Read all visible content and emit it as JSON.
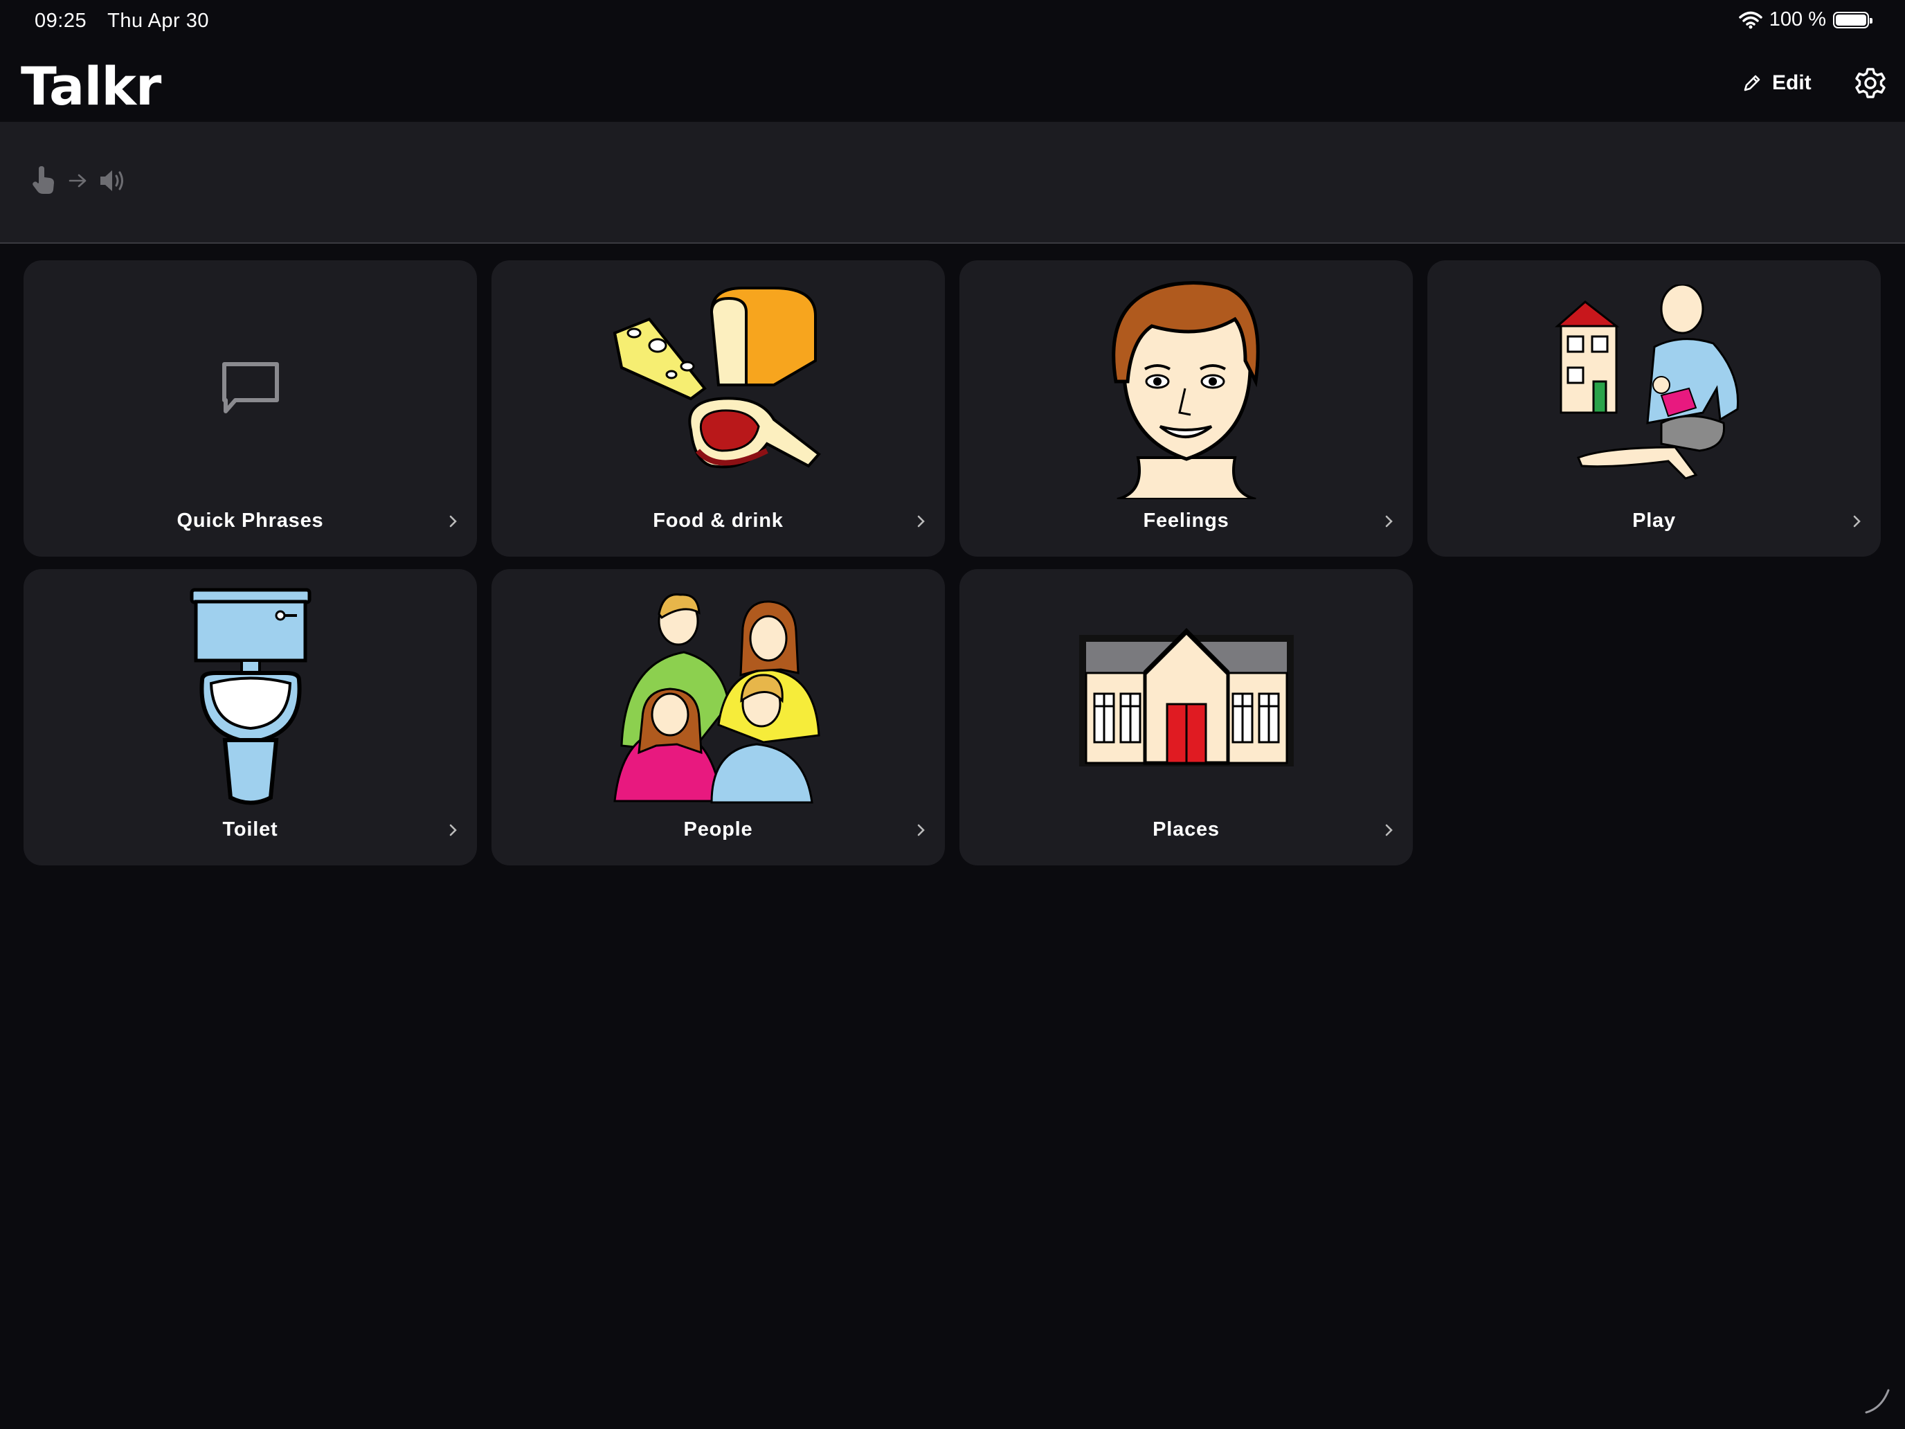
{
  "status_bar": {
    "time": "09:25",
    "date": "Thu Apr 30",
    "battery": "100 %"
  },
  "header": {
    "app_title": "Talkr",
    "edit_label": "Edit"
  },
  "tiles": [
    {
      "label": "Quick Phrases",
      "icon": "chat-bubble-icon"
    },
    {
      "label": "Food & drink",
      "icon": "food-icon"
    },
    {
      "label": "Feelings",
      "icon": "face-icon"
    },
    {
      "label": "Play",
      "icon": "play-icon"
    },
    {
      "label": "Toilet",
      "icon": "toilet-icon"
    },
    {
      "label": "People",
      "icon": "people-icon"
    },
    {
      "label": "Places",
      "icon": "building-icon"
    }
  ],
  "colors": {
    "background": "#0b0b0f",
    "tile": "#1c1c21",
    "sentence_bar": "#1c1c21",
    "hint_icon": "#6d6d72"
  }
}
